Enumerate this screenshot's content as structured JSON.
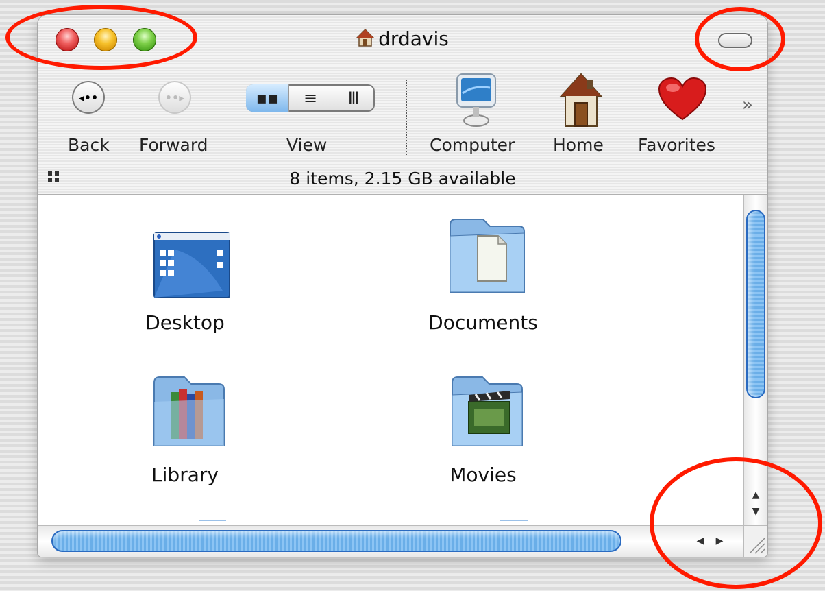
{
  "window": {
    "title": "drdavis"
  },
  "toolbar": {
    "back_label": "Back",
    "forward_label": "Forward",
    "view_label": "View",
    "computer_label": "Computer",
    "home_label": "Home",
    "favorites_label": "Favorites",
    "overflow_icon": "double-chevron-right-icon",
    "view_modes": [
      "icon",
      "list",
      "column"
    ],
    "active_view": "icon"
  },
  "status": {
    "text": "8 items, 2.15 GB available"
  },
  "files": [
    {
      "name": "Desktop",
      "icon": "desktop-folder-icon"
    },
    {
      "name": "Documents",
      "icon": "documents-folder-icon"
    },
    {
      "name": "Library",
      "icon": "library-folder-icon"
    },
    {
      "name": "Movies",
      "icon": "movies-folder-icon"
    }
  ],
  "colors": {
    "close": "#e03a3a",
    "minimize": "#f0b51c",
    "zoom": "#5cb832",
    "scroll_thumb": "#7ab8ee",
    "highlight_circle": "#ff1a00"
  }
}
